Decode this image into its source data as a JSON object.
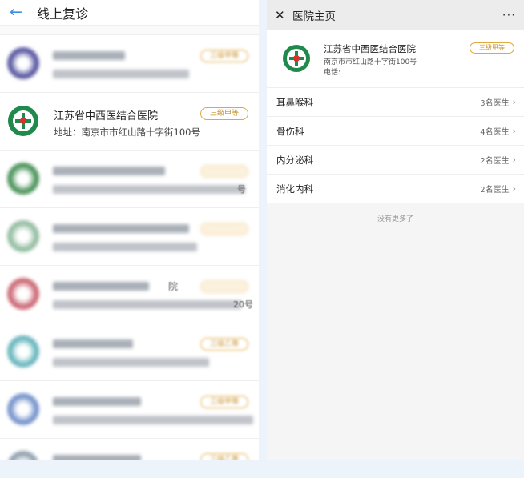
{
  "left": {
    "title": "线上复诊",
    "hospitals": [
      {
        "name": "",
        "address": "",
        "badge": "三级甲等",
        "blurred": true,
        "logo_color": "#4a4a9a"
      },
      {
        "name": "江苏省中西医结合医院",
        "address": "地址：南京市市红山路十字街100号",
        "badge": "三级甲等",
        "blurred": false,
        "logo_color": "#1f8a4c"
      },
      {
        "name": "",
        "address": "",
        "badge": "",
        "blurred": true,
        "stray_text": "号",
        "logo_color": "#3a8a4a"
      },
      {
        "name": "",
        "address": "",
        "badge": "",
        "blurred": true,
        "logo_color": "#8ab89a"
      },
      {
        "name": "",
        "address": "",
        "badge": "",
        "blurred": true,
        "stray_name": "院",
        "stray_text": "20号",
        "logo_color": "#c85c6a"
      },
      {
        "name": "",
        "address": "",
        "badge": "三级乙等",
        "blurred": true,
        "logo_color": "#5ab0b8"
      },
      {
        "name": "",
        "address": "",
        "badge": "三级甲等",
        "blurred": true,
        "logo_color": "#6a8ac8"
      },
      {
        "name": "",
        "address": "",
        "badge": "三级乙等",
        "blurred": true,
        "logo_color": "#889aaa"
      }
    ]
  },
  "right": {
    "title": "医院主页",
    "more": "···",
    "hospital": {
      "name": "江苏省中西医结合医院",
      "address": "南京市市红山路十字街100号",
      "phone_label": "电话:",
      "badge": "三级甲等"
    },
    "departments": [
      {
        "name": "耳鼻喉科",
        "count": "3名医生"
      },
      {
        "name": "骨伤科",
        "count": "4名医生"
      },
      {
        "name": "内分泌科",
        "count": "2名医生"
      },
      {
        "name": "消化内科",
        "count": "2名医生"
      }
    ],
    "no_more": "没有更多了"
  },
  "colors": {
    "accent": "#3c8ee8",
    "badge": "#e0a93a",
    "logo_green": "#1f8a4c"
  }
}
